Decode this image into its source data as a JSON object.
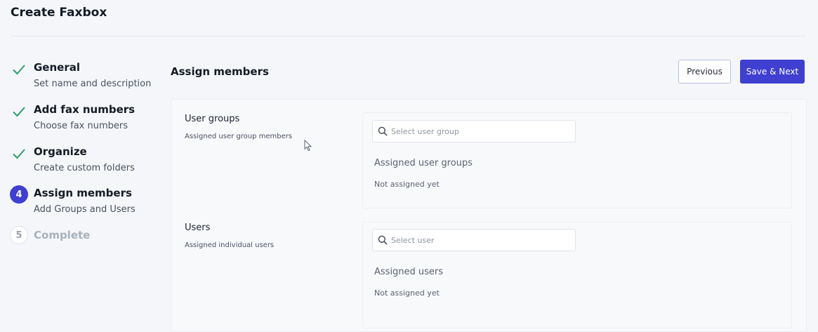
{
  "page": {
    "title": "Create Faxbox"
  },
  "steps": [
    {
      "state": "done",
      "marker": "",
      "title": "General",
      "description": "Set name and description"
    },
    {
      "state": "done",
      "marker": "",
      "title": "Add fax numbers",
      "description": "Choose fax numbers"
    },
    {
      "state": "done",
      "marker": "",
      "title": "Organize",
      "description": "Create custom folders"
    },
    {
      "state": "active",
      "marker": "4",
      "title": "Assign members",
      "description": "Add Groups and Users"
    },
    {
      "state": "pending",
      "marker": "5",
      "title": "Complete",
      "description": ""
    }
  ],
  "main": {
    "title": "Assign members",
    "previous_label": "Previous",
    "save_next_label": "Save & Next"
  },
  "user_groups": {
    "label": "User groups",
    "sublabel": "Assigned user group members",
    "search_placeholder": "Select user group",
    "assigned_heading": "Assigned user groups",
    "assigned_value": "Not assigned yet"
  },
  "users": {
    "label": "Users",
    "sublabel": "Assigned individual users",
    "search_placeholder": "Select user",
    "assigned_heading": "Assigned users",
    "assigned_value": "Not assigned yet"
  },
  "colors": {
    "accent": "#3f3fd1",
    "check": "#2e9e6b"
  },
  "icons": {
    "done": "check-icon",
    "search": "search-icon",
    "cursor": "mouse-cursor-icon"
  }
}
